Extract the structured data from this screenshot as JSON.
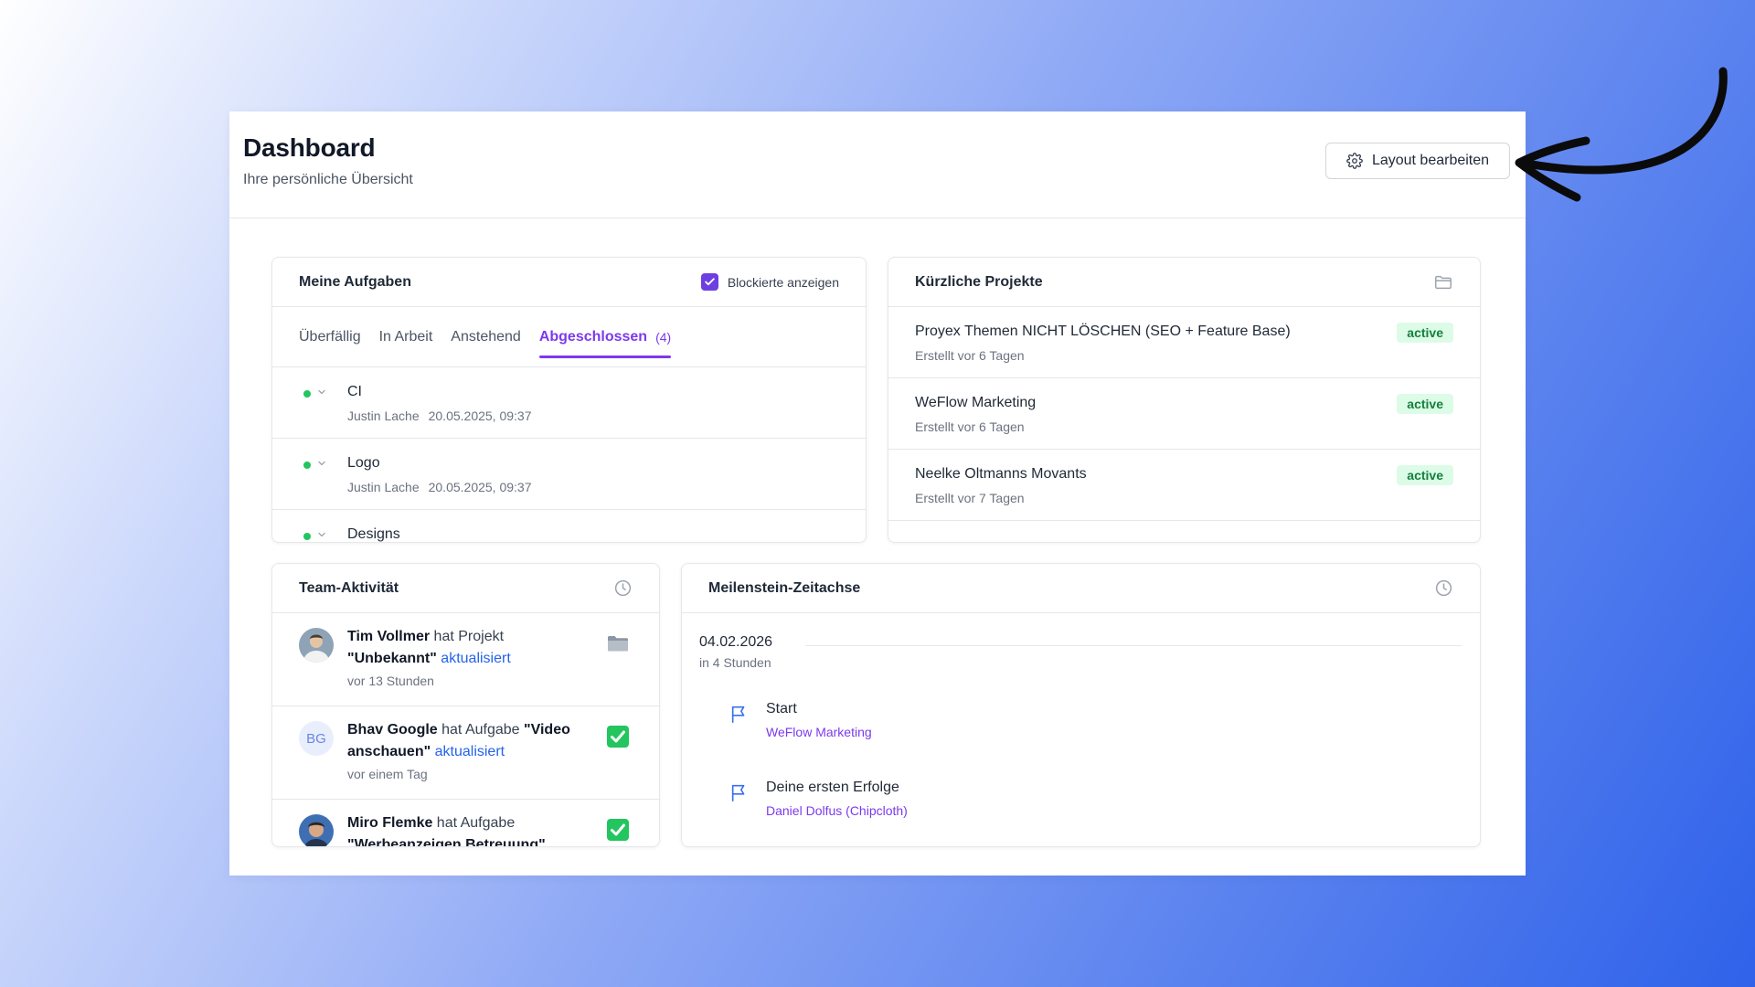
{
  "header": {
    "title": "Dashboard",
    "subtitle": "Ihre persönliche Übersicht",
    "layout_button_label": "Layout bearbeiten"
  },
  "tasks": {
    "title": "Meine Aufgaben",
    "blocked_label": "Blockierte anzeigen",
    "blocked_checked": true,
    "tabs": [
      {
        "label": "Überfällig"
      },
      {
        "label": "In Arbeit"
      },
      {
        "label": "Anstehend"
      },
      {
        "label": "Abgeschlossen",
        "count": "(4)",
        "active": true
      }
    ],
    "items": [
      {
        "name": "CI",
        "assignee": "Justin Lache",
        "date": "20.05.2025, 09:37"
      },
      {
        "name": "Logo",
        "assignee": "Justin Lache",
        "date": "20.05.2025, 09:37"
      },
      {
        "name": "Designs",
        "assignee": "",
        "date": ""
      }
    ]
  },
  "projects": {
    "title": "Kürzliche Projekte",
    "icon": "folder-icon",
    "items": [
      {
        "name": "Proyex Themen NICHT LÖSCHEN (SEO + Feature Base)",
        "created": "Erstellt vor 6 Tagen",
        "status": "active"
      },
      {
        "name": "WeFlow Marketing",
        "created": "Erstellt vor 6 Tagen",
        "status": "active"
      },
      {
        "name": "Neelke Oltmanns Movants",
        "created": "Erstellt vor 7 Tagen",
        "status": "active"
      }
    ]
  },
  "team": {
    "title": "Team-Aktivität",
    "icon": "clock-icon",
    "items": [
      {
        "user": "Tim Vollmer",
        "verb": " hat Projekt ",
        "object": "\"Unbekannt\"",
        "action": "aktualisiert",
        "time": "vor 13 Stunden",
        "icon": "folder-icon"
      },
      {
        "user": "Bhav Google",
        "initials": "BG",
        "verb": " hat Aufgabe ",
        "object": "\"Video anschauen\"",
        "action": "aktualisiert",
        "time": "vor einem Tag",
        "icon": "check-icon"
      },
      {
        "user": "Miro Flemke",
        "verb": " hat Aufgabe ",
        "object": "\"Werbeanzeigen Betreuung\"",
        "action": "",
        "time": "",
        "icon": "check-icon"
      }
    ]
  },
  "milestones": {
    "title": "Meilenstein-Zeitachse",
    "icon": "clock-icon",
    "date": "04.02.2026",
    "relative": "in 4 Stunden",
    "items": [
      {
        "title": "Start",
        "project": "WeFlow Marketing"
      },
      {
        "title": "Deine ersten Erfolge",
        "project": "Daniel Dolfus (Chipcloth)"
      }
    ]
  },
  "colors": {
    "accent": "#7c3aed",
    "link": "#2563eb",
    "active_badge_bg": "#dcfce7",
    "active_badge_text": "#15803d",
    "status_dot": "#22c55e"
  }
}
